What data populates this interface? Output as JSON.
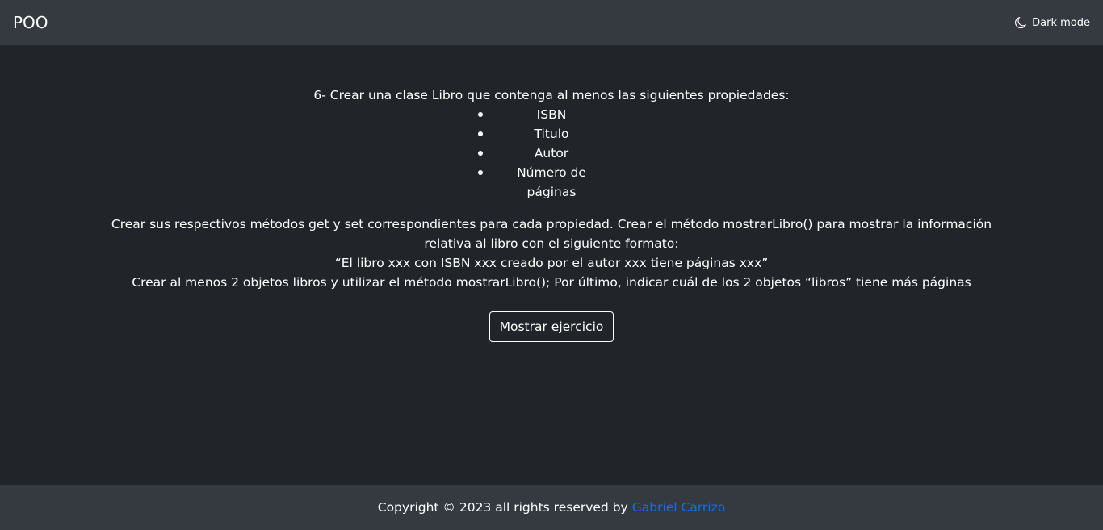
{
  "navbar": {
    "brand": "POO",
    "dark_mode_label": "Dark mode",
    "dark_mode_icon": "moon-icon"
  },
  "main": {
    "intro": "6- Crear una clase Libro que contenga al menos las siguientes propiedades:",
    "properties": [
      "ISBN",
      "Titulo",
      "Autor",
      "Número de páginas"
    ],
    "description_lines": [
      "Crear sus respectivos métodos get y set correspondientes para cada propiedad. Crear el método mostrarLibro() para mostrar la información relativa al libro con el siguiente formato:",
      "“El libro xxx con ISBN xxx creado por el autor xxx tiene páginas xxx”",
      "Crear al menos 2 objetos libros y utilizar el método mostrarLibro(); Por último, indicar cuál de los 2 objetos “libros” tiene más páginas"
    ],
    "button_label": "Mostrar ejercicio"
  },
  "footer": {
    "text": "Copyright © 2023 all rights reserved by",
    "link_text": "Gabriel Carrizo",
    "link_color": "#0d6efd"
  },
  "colors": {
    "background": "#212529",
    "navbar": "#343a40"
  }
}
